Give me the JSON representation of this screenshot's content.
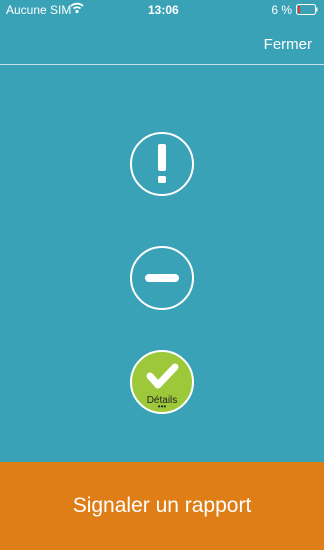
{
  "status_bar": {
    "carrier": "Aucune SIM",
    "time": "13:06",
    "battery_percent": "6 %"
  },
  "header": {
    "close_label": "Fermer"
  },
  "status_options": {
    "ok": {
      "details_label": "Détails",
      "details_dots": "•••"
    }
  },
  "footer": {
    "report_button_label": "Signaler un rapport"
  },
  "colors": {
    "background": "#3aa2b7",
    "ok_green": "#9cc83a",
    "report_orange": "#df7e16",
    "battery_low": "#e53935"
  },
  "icons": {
    "wifi": "wifi-icon",
    "battery": "battery-icon",
    "warning": "exclamation-icon",
    "neutral": "minus-icon",
    "ok": "checkmark-icon"
  }
}
